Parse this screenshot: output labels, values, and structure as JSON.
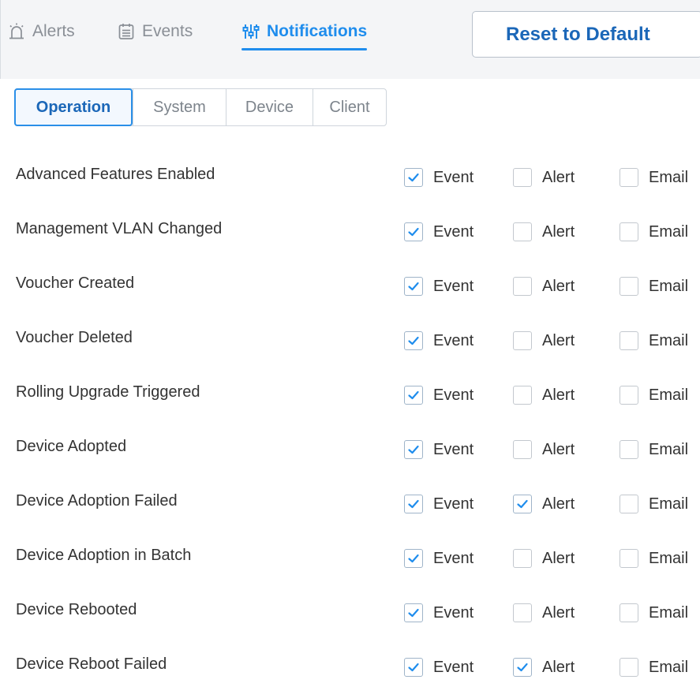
{
  "header": {
    "tabs": [
      {
        "label": "Alerts",
        "icon": "alarm-icon",
        "active": false
      },
      {
        "label": "Events",
        "icon": "list-icon",
        "active": false
      },
      {
        "label": "Notifications",
        "icon": "sliders-icon",
        "active": true
      }
    ],
    "reset_label": "Reset to Default"
  },
  "subtabs": [
    {
      "label": "Operation",
      "active": true
    },
    {
      "label": "System",
      "active": false
    },
    {
      "label": "Device",
      "active": false
    },
    {
      "label": "Client",
      "active": false
    }
  ],
  "option_labels": {
    "event": "Event",
    "alert": "Alert",
    "email": "Email"
  },
  "rows": [
    {
      "label": "Advanced Features Enabled",
      "event": true,
      "alert": false,
      "email": false
    },
    {
      "label": "Management VLAN Changed",
      "event": true,
      "alert": false,
      "email": false
    },
    {
      "label": "Voucher Created",
      "event": true,
      "alert": false,
      "email": false
    },
    {
      "label": "Voucher Deleted",
      "event": true,
      "alert": false,
      "email": false
    },
    {
      "label": "Rolling Upgrade Triggered",
      "event": true,
      "alert": false,
      "email": false
    },
    {
      "label": "Device Adopted",
      "event": true,
      "alert": false,
      "email": false
    },
    {
      "label": "Device Adoption Failed",
      "event": true,
      "alert": true,
      "email": false
    },
    {
      "label": "Device Adoption in Batch",
      "event": true,
      "alert": false,
      "email": false
    },
    {
      "label": "Device Rebooted",
      "event": true,
      "alert": false,
      "email": false
    },
    {
      "label": "Device Reboot Failed",
      "event": true,
      "alert": true,
      "email": false
    }
  ],
  "colors": {
    "accent": "#1f8ded",
    "check": "#1f8ded",
    "text": "#333333",
    "muted": "#8a8f96"
  }
}
